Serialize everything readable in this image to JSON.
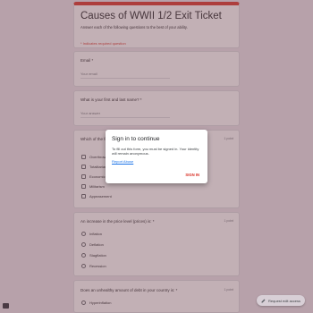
{
  "form": {
    "title": "Causes of WWII 1/2 Exit Ticket",
    "description": "Answer each of the following questions to the best of your ability.",
    "required_note": "* Indicates required question"
  },
  "questions": [
    {
      "label": "Email *",
      "placeholder": "Your email"
    },
    {
      "label": "What is your first and last name? *",
      "placeholder": "Your answer"
    },
    {
      "label": "Which of the following were causes of WWII? Check all that apply.",
      "points": "1 point",
      "options": [
        "Overthrow of governments",
        "Totalitarianism",
        "Economic depression",
        "Militarism",
        "Appeasement"
      ]
    },
    {
      "label": "An increase in the price level (prices) is: *",
      "points": "1 point",
      "options": [
        "Inflation",
        "Deflation",
        "Stagflation",
        "Recession"
      ]
    },
    {
      "label": "Does an unhealthy amount of debt in your country is: *",
      "points": "1 point",
      "options": [
        "Hyperinflation"
      ]
    }
  ],
  "dialog": {
    "title": "Sign in to continue",
    "text": "To fill out this form, you must be signed in. Your identity will remain anonymous.",
    "link": "Report Abuse",
    "button": "SIGN IN"
  },
  "footer": {
    "request_button": "Request edit access"
  },
  "colors": {
    "accent": "#d93025",
    "link": "#1a73e8",
    "overlay": "#785a5a"
  }
}
